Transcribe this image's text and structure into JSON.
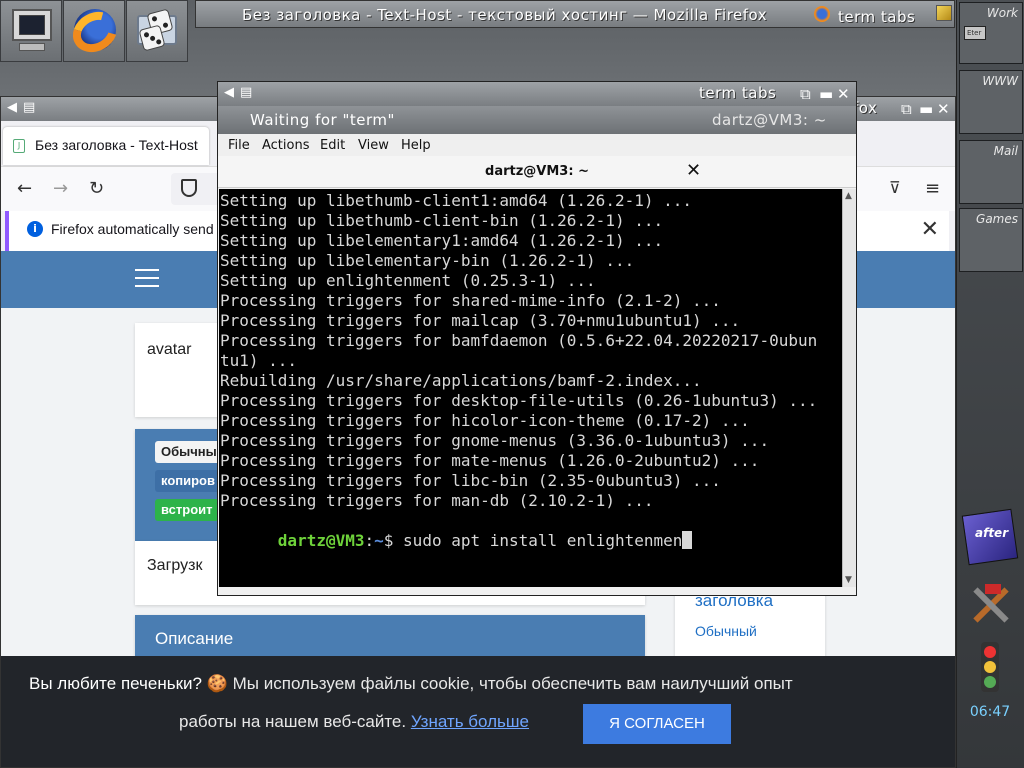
{
  "desktop": {
    "top_title": "Без заголовка - Text-Host - текстовый хостинг — Mozilla Firefox",
    "top_title_tabs": "term tabs",
    "launchers": [
      "monitor-icon",
      "firefox-icon",
      "games-icon"
    ],
    "pager": {
      "desktops": [
        "Work",
        "WWW",
        "Mail",
        "Games"
      ],
      "mini_window": "Eter"
    },
    "clock": "06:47",
    "colors": {
      "clock": "#7ad1ff",
      "accent": "#4a7db2"
    }
  },
  "firefox": {
    "window_title": "fox",
    "tab_label": "Без заголовка - Text-Host",
    "notice": "Firefox automatically send",
    "page": {
      "avatar_text": "avatar",
      "tags": [
        "Обычны",
        "копиров",
        "встроит"
      ],
      "load_text": "Загрузк",
      "desc_heading": "Описание",
      "side_link_1": "заголовка",
      "side_link_2": "Обычный"
    },
    "cookie": {
      "line1_strong": "Вы любите печеньки?",
      "line1_rest": "Мы используем файлы cookie, чтобы обеспечить вам наилучший опыт",
      "line2": "работы на нашем веб-сайте.",
      "learn_more": "Узнать больше",
      "accept": "Я СОГЛАСЕН"
    }
  },
  "terminal": {
    "window_title": "term tabs",
    "tab_waiting": "Waiting for \"term\"",
    "tab_active": "dartz@VM3: ~",
    "menu": [
      "File",
      "Actions",
      "Edit",
      "View",
      "Help"
    ],
    "header_title": "dartz@VM3: ~",
    "lines": [
      "Setting up libethumb-client1:amd64 (1.26.2-1) ...",
      "Setting up libethumb-client-bin (1.26.2-1) ...",
      "Setting up libelementary1:amd64 (1.26.2-1) ...",
      "Setting up libelementary-bin (1.26.2-1) ...",
      "Setting up enlightenment (0.25.3-1) ...",
      "Processing triggers for shared-mime-info (2.1-2) ...",
      "Processing triggers for mailcap (3.70+nmu1ubuntu1) ...",
      "Processing triggers for bamfdaemon (0.5.6+22.04.20220217-0ubun",
      "tu1) ...",
      "Rebuilding /usr/share/applications/bamf-2.index...",
      "Processing triggers for desktop-file-utils (0.26-1ubuntu3) ...",
      "Processing triggers for hicolor-icon-theme (0.17-2) ...",
      "Processing triggers for gnome-menus (3.36.0-1ubuntu3) ...",
      "Processing triggers for mate-menus (1.26.0-2ubuntu2) ...",
      "Processing triggers for libc-bin (2.35-0ubuntu3) ...",
      "Processing triggers for man-db (2.10.2-1) ..."
    ],
    "prompt_user": "dartz@VM3",
    "prompt_sep": ":",
    "prompt_path": "~",
    "prompt_dollar": "$ ",
    "command": "sudo apt install enlightenmen"
  }
}
